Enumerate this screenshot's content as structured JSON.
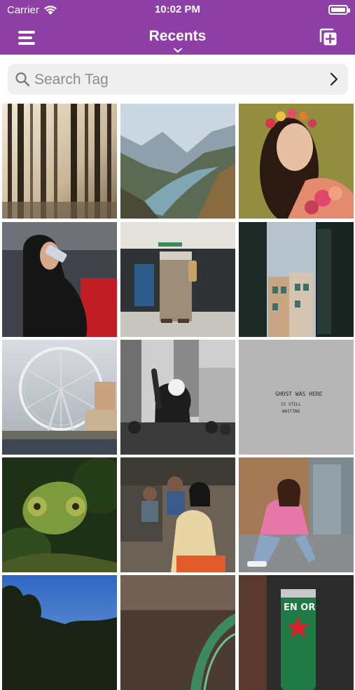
{
  "status": {
    "carrier": "Carrier",
    "time": "10:02 PM"
  },
  "nav": {
    "title": "Recents",
    "menu_icon": "menu-icon",
    "add_icon": "add-to-collection-icon",
    "accent": "#8e3fa6"
  },
  "search": {
    "placeholder": "Search Tag",
    "value": ""
  },
  "photos": [
    {
      "name": "forest-sunbeams"
    },
    {
      "name": "mountain-river-valley"
    },
    {
      "name": "woman-flower-crown"
    },
    {
      "name": "woman-on-phone-red-car"
    },
    {
      "name": "person-standing-doorway"
    },
    {
      "name": "narrow-street-buildings"
    },
    {
      "name": "london-eye"
    },
    {
      "name": "protest-crowd-bw"
    },
    {
      "name": "wall-graffiti-ghost-was-here",
      "caption_lines": [
        "GHOST WAS HERE",
        "IS STILL",
        "WAITING"
      ]
    },
    {
      "name": "green-chameleon"
    },
    {
      "name": "woman-with-children"
    },
    {
      "name": "woman-pink-sweater-sitting"
    },
    {
      "name": "trees-blue-sky"
    },
    {
      "name": "bridge-arch-blur"
    },
    {
      "name": "beer-can-red-star",
      "label": "EN OR"
    }
  ]
}
